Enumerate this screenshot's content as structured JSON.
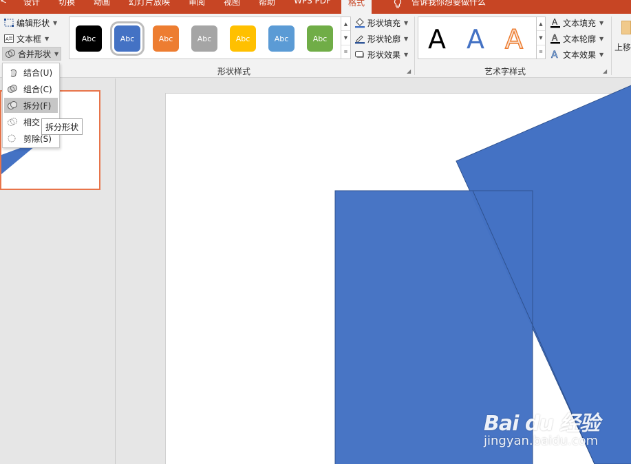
{
  "tabs": {
    "design": "设计",
    "transitions": "切换",
    "animations": "动画",
    "slideshow": "幻灯片放映",
    "review": "审阅",
    "view": "视图",
    "help": "帮助",
    "wps_pdf": "WPS PDF",
    "format": "格式",
    "tell_me": "告诉我你想要做什么"
  },
  "insert_shapes": {
    "edit_shape": "编辑形状",
    "text_box": "文本框",
    "merge_shapes": "合并形状"
  },
  "shape_styles": {
    "label": "形状样式",
    "swatches": [
      {
        "text": "Abc",
        "color": "#000000"
      },
      {
        "text": "Abc",
        "color": "#4472c4"
      },
      {
        "text": "Abc",
        "color": "#ed7d31"
      },
      {
        "text": "Abc",
        "color": "#a5a5a5"
      },
      {
        "text": "Abc",
        "color": "#ffc000"
      },
      {
        "text": "Abc",
        "color": "#5b9bd5"
      },
      {
        "text": "Abc",
        "color": "#70ad47"
      }
    ],
    "fill": "形状填充",
    "outline": "形状轮廓",
    "effects": "形状效果"
  },
  "wordart_styles": {
    "label": "艺术字样式",
    "letters": [
      "A",
      "A",
      "A"
    ],
    "text_fill": "文本填充",
    "text_outline": "文本轮廓",
    "text_effects": "文本效果"
  },
  "arrange": {
    "move_up": "上移"
  },
  "merge_menu": {
    "union": "结合(U)",
    "combine": "组合(C)",
    "fragment": "拆分(F)",
    "intersect": "相交",
    "subtract": "剪除(S)",
    "tooltip": "拆分形状"
  },
  "colors": {
    "accent": "#c74524",
    "shape_blue": "#4472c4",
    "selection_border": "#e8744a"
  },
  "watermark": {
    "logo": "Bai du 经验",
    "url": "jingyan.baidu.com"
  }
}
